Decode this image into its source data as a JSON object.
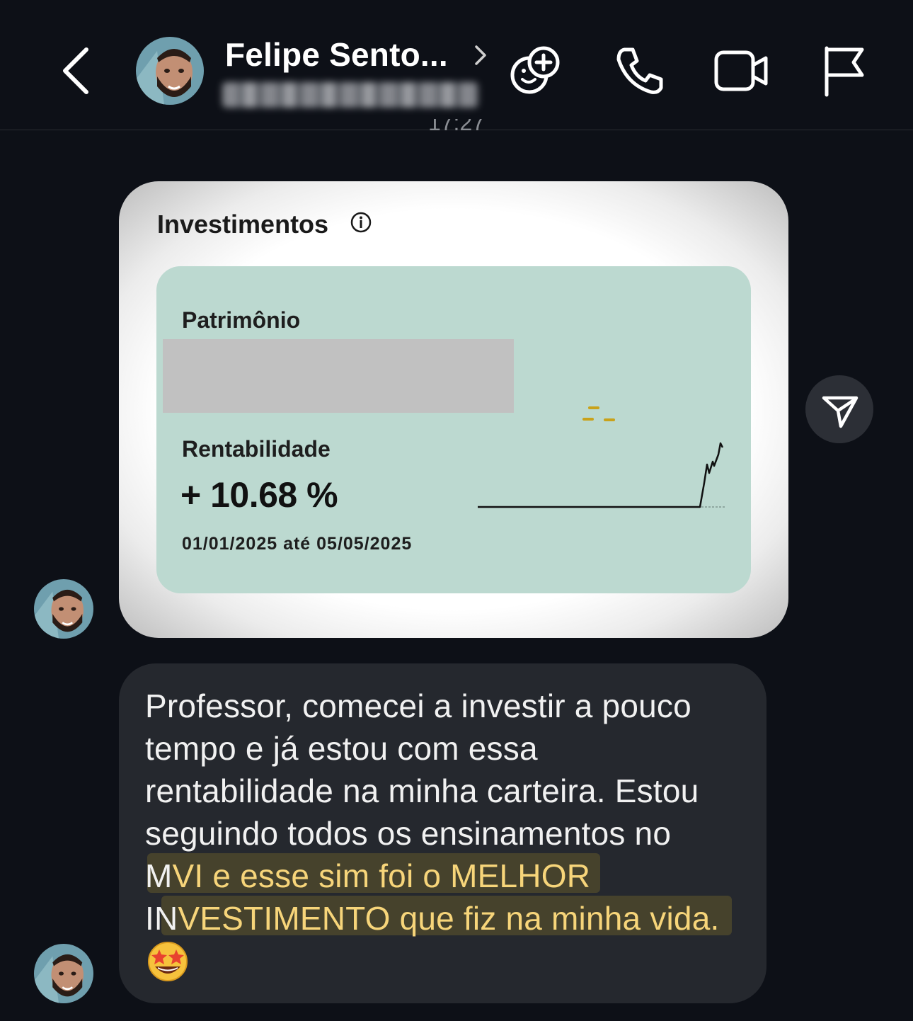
{
  "header": {
    "contact_name": "Felipe Sento...",
    "back_icon": "chevron-left-icon",
    "icons": [
      "add-effect-icon",
      "phone-icon",
      "video-icon",
      "flag-icon"
    ]
  },
  "conversation": {
    "timestamp": "17:27"
  },
  "investment_card": {
    "title": "Investimentos",
    "patrimonio_label": "Patrimônio",
    "rentabilidade_label": "Rentabilidade",
    "rentabilidade_value": "+ 10.68 %",
    "date_range": "01/01/2025 até 05/05/2025",
    "accent_color": "#bcd9d0"
  },
  "message": {
    "lines": [
      "Professor, comecei a investir a pouco",
      "tempo e já estou com essa",
      "rentabilidade na minha carteira. Estou",
      "seguindo todos os ensinamentos no"
    ],
    "highlight_line1_prefix": "M",
    "highlight_line1": "VI e esse sim foi o MELHOR",
    "highlight_line2_prefix": "IN",
    "highlight_line2": "VESTIMENTO que fiz na minha vida.",
    "emoji": "star-struck-emoji",
    "highlight_color": "#f7d57a"
  }
}
